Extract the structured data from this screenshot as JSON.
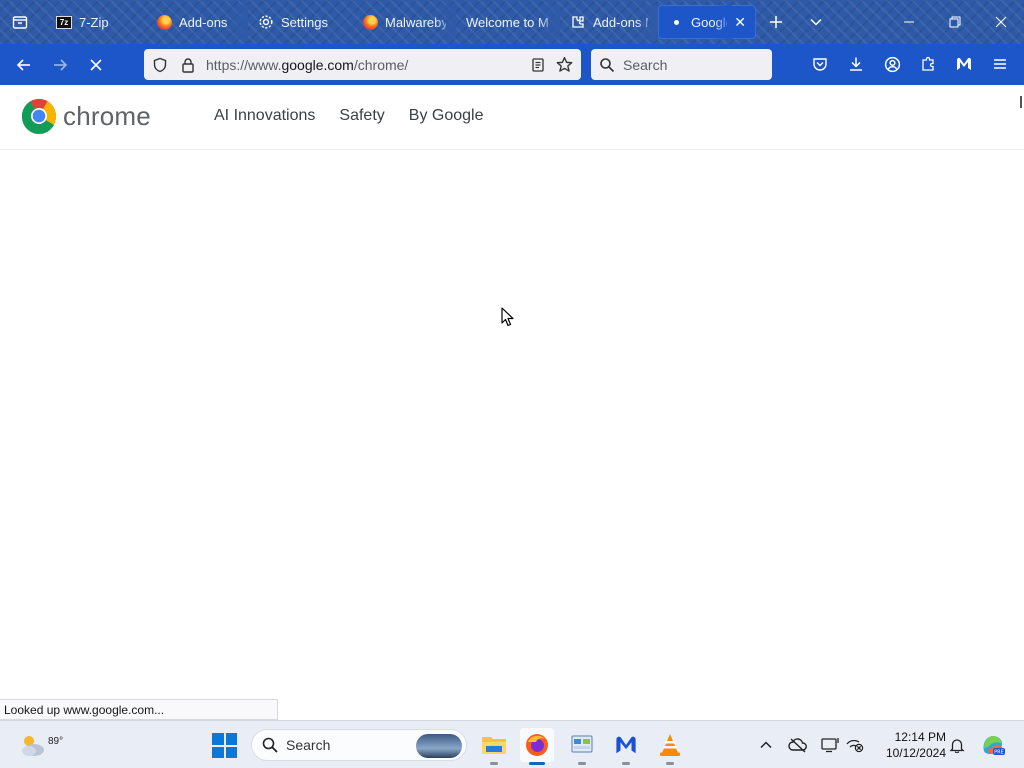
{
  "tabs": [
    {
      "label": "7-Zip",
      "icon": "7zip-icon"
    },
    {
      "label": "Add-ons",
      "icon": "firefox-icon"
    },
    {
      "label": "Settings",
      "icon": "gear-icon"
    },
    {
      "label": "Malwareby",
      "icon": "firefox-icon"
    },
    {
      "label": "Welcome to M",
      "icon": "none"
    },
    {
      "label": "Add-ons M",
      "icon": "puzzle-icon"
    },
    {
      "label": "Google",
      "icon": "loading-dot-icon",
      "active": true
    }
  ],
  "address_bar": {
    "url_prefix": "https://www.",
    "url_host": "google.com",
    "url_path": "/chrome/"
  },
  "search_bar": {
    "placeholder": "Search"
  },
  "page": {
    "logo_word": "chrome",
    "nav": [
      "AI Innovations",
      "Safety",
      "By Google"
    ]
  },
  "status_text": "Looked up www.google.com...",
  "taskbar": {
    "weather_temp": "89°",
    "search_label": "Search",
    "time": "12:14 PM",
    "date": "10/12/2024"
  },
  "colors": {
    "tabstrip_bg": "#2e5aa8",
    "navbar_bg": "#1c56c9",
    "taskbar_bg": "#e9eef6"
  }
}
